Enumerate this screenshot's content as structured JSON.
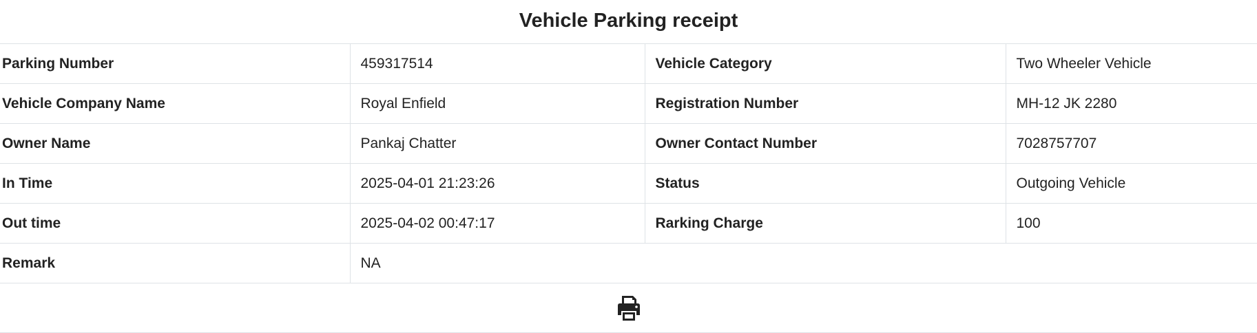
{
  "title": "Vehicle Parking receipt",
  "rows": [
    {
      "label1": "Parking Number",
      "value1": "459317514",
      "label2": "Vehicle Category",
      "value2": "Two Wheeler Vehicle"
    },
    {
      "label1": "Vehicle Company Name",
      "value1": "Royal Enfield",
      "label2": "Registration Number",
      "value2": "MH-12 JK 2280"
    },
    {
      "label1": "Owner Name",
      "value1": "Pankaj Chatter",
      "label2": "Owner Contact Number",
      "value2": "7028757707"
    },
    {
      "label1": "In Time",
      "value1": "2025-04-01 21:23:26",
      "label2": "Status",
      "value2": "Outgoing Vehicle"
    },
    {
      "label1": "Out time",
      "value1": "2025-04-02 00:47:17",
      "label2": "Rarking Charge",
      "value2": "100"
    }
  ],
  "remark": {
    "label": "Remark",
    "value": "NA"
  },
  "print": {
    "icon": "print-icon"
  }
}
